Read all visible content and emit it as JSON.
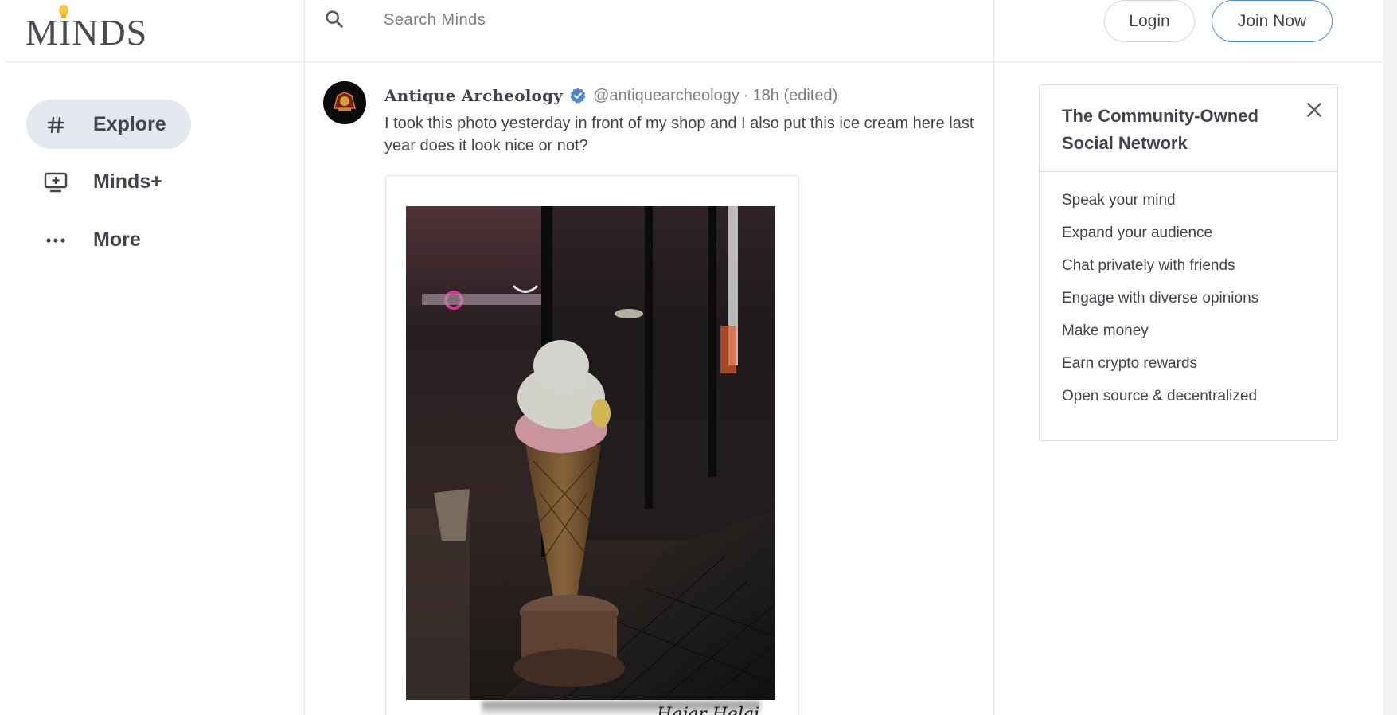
{
  "header": {
    "logo_text": "MINDS",
    "search_placeholder": "Search Minds",
    "login_label": "Login",
    "join_label": "Join Now"
  },
  "nav": {
    "items": [
      {
        "icon": "hashtag-icon",
        "label": "Explore",
        "active": true
      },
      {
        "icon": "tv-plus-icon",
        "label": "Minds+",
        "active": false
      },
      {
        "icon": "more-dots-icon",
        "label": "More",
        "active": false
      }
    ]
  },
  "post": {
    "author": "Antique Archeology",
    "verified": true,
    "handle": "@antiquearcheology",
    "separator": "·",
    "time": "18h (edited)",
    "text": "I took this photo yesterday in front of my shop and I also put this ice cream here last year does it look nice or not?",
    "image_icon": "ice-cream-photo",
    "signature": "Hajar Helai"
  },
  "sidebar_card": {
    "title": "The Community-Owned Social Network",
    "features": [
      "Speak your mind",
      "Expand your audience",
      "Chat privately with friends",
      "Engage with diverse opinions",
      "Make money",
      "Earn crypto rewards",
      "Open source & decentralized"
    ]
  },
  "colors": {
    "accent_blue": "#4f87c9",
    "text": "#43434d",
    "muted": "#7d7d85",
    "active_nav_bg": "#e3e7ee",
    "border": "#e3e4e9"
  }
}
